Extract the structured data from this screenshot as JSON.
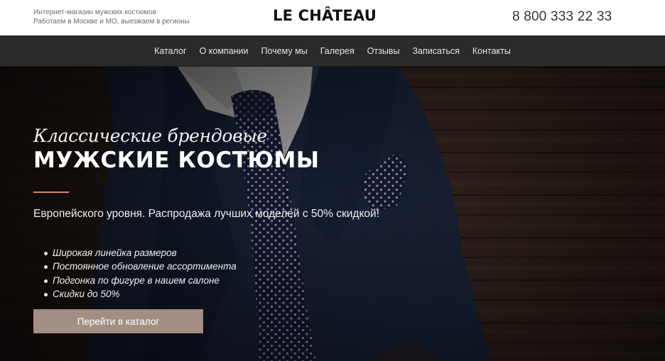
{
  "header": {
    "tagline_line1": "Интернет-магазин мужских костюмов",
    "tagline_line2": "Работаем в Москве и МО, выезжаем в регионы",
    "logo": "LE CHÂTEAU",
    "phone": "8 800 333 22 33"
  },
  "nav": {
    "items": [
      "Каталог",
      "О компании",
      "Почему мы",
      "Галерея",
      "Отзывы",
      "Записаться",
      "Контакты"
    ]
  },
  "hero": {
    "subtitle": "Классические брендовые",
    "title": "МУЖСКИЕ КОСТЮМЫ",
    "lead": "Европейского уровня. Распродажа лучших моделей с 50% скидкой!",
    "features": [
      "Широкая линейка размеров",
      "Постоянное обновление ассортимента",
      "Подгонка по фигуре в нашем салоне",
      "Скидки до 50%"
    ],
    "cta_label": "Перейти в каталог"
  },
  "colors": {
    "nav_background": "#2b2a29",
    "accent_line": "#d9866a",
    "cta_background": "#a38e82",
    "suit": "#1f2a44",
    "tie": "#1c2040"
  }
}
